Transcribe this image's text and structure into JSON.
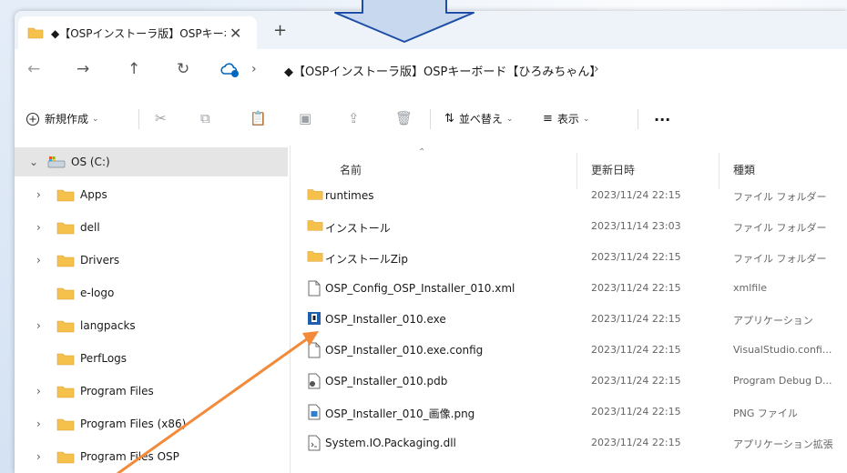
{
  "tab": {
    "title": "◆【OSPインストーラ版】OSPキーボ·",
    "close": "✕",
    "new_tab": "+"
  },
  "nav": {
    "back": "←",
    "forward": "→",
    "up": "↑",
    "refresh": "↻",
    "sep": "›"
  },
  "address": {
    "path": "◆【OSPインストーラ版】OSPキーボード【ひろみちゃん】"
  },
  "commands": {
    "new_label": "新規作成",
    "sort_label": "並べ替え",
    "view_label": "表示",
    "more": "···"
  },
  "tree": [
    {
      "label": "OS (C:)",
      "chevron": "⌄",
      "icon": "drive-icon",
      "selected": true
    },
    {
      "label": "Apps",
      "chevron": "›",
      "icon": "folder-icon"
    },
    {
      "label": "dell",
      "chevron": "›",
      "icon": "folder-icon"
    },
    {
      "label": "Drivers",
      "chevron": "›",
      "icon": "folder-icon"
    },
    {
      "label": "e-logo",
      "chevron": "",
      "icon": "folder-icon"
    },
    {
      "label": "langpacks",
      "chevron": "›",
      "icon": "folder-icon"
    },
    {
      "label": "PerfLogs",
      "chevron": "",
      "icon": "folder-icon"
    },
    {
      "label": "Program Files",
      "chevron": "›",
      "icon": "folder-icon"
    },
    {
      "label": "Program Files (x86)",
      "chevron": "›",
      "icon": "folder-icon"
    },
    {
      "label": "Program Files OSP",
      "chevron": "›",
      "icon": "folder-icon"
    }
  ],
  "columns": {
    "name": "名前",
    "modified": "更新日時",
    "type": "種類"
  },
  "files": [
    {
      "name": "runtimes",
      "date": "2023/11/24 22:15",
      "type": "ファイル フォルダー",
      "icon": "folder-icon"
    },
    {
      "name": "インストール",
      "date": "2023/11/14 23:03",
      "type": "ファイル フォルダー",
      "icon": "folder-icon"
    },
    {
      "name": "インストールZip",
      "date": "2023/11/24 22:15",
      "type": "ファイル フォルダー",
      "icon": "folder-icon"
    },
    {
      "name": "OSP_Config_OSP_Installer_010.xml",
      "date": "2023/11/24 22:15",
      "type": "xmlfile",
      "icon": "file-icon"
    },
    {
      "name": "OSP_Installer_010.exe",
      "date": "2023/11/24 22:15",
      "type": "アプリケーション",
      "icon": "exe-icon"
    },
    {
      "name": "OSP_Installer_010.exe.config",
      "date": "2023/11/24 22:15",
      "type": "VisualStudio.confi...",
      "icon": "file-icon"
    },
    {
      "name": "OSP_Installer_010.pdb",
      "date": "2023/11/24 22:15",
      "type": "Program Debug D...",
      "icon": "pdb-icon"
    },
    {
      "name": "OSP_Installer_010_画像.png",
      "date": "2023/11/24 22:15",
      "type": "PNG ファイル",
      "icon": "image-icon"
    },
    {
      "name": "System.IO.Packaging.dll",
      "date": "2023/11/24 22:15",
      "type": "アプリケーション拡張",
      "icon": "dll-icon"
    }
  ],
  "colors": {
    "folder": "#f5c14a",
    "accent": "#0067c0",
    "annotation_arrow": "#f28a3a",
    "callout_arrow": "#1f4ea8"
  }
}
